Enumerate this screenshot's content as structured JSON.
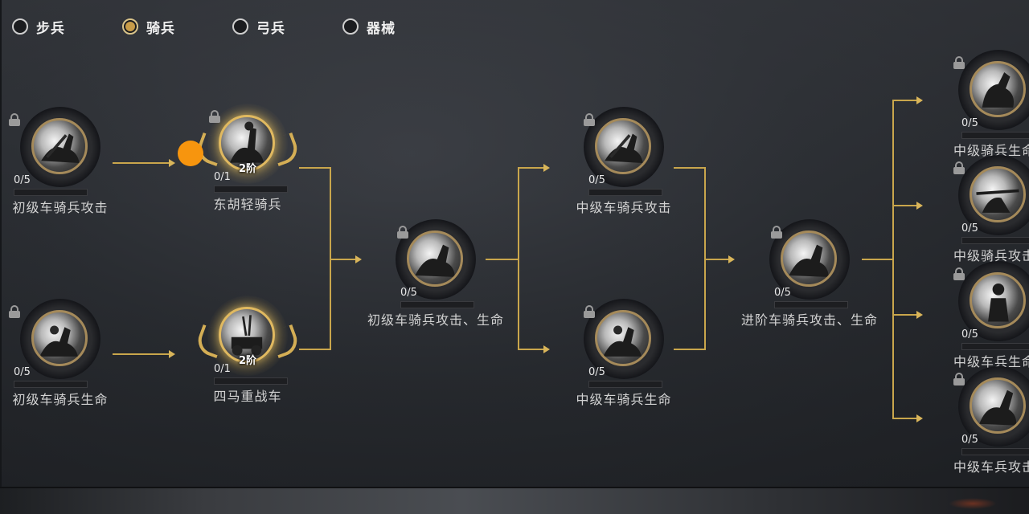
{
  "tabs": [
    {
      "label": "步兵",
      "selected": false
    },
    {
      "label": "骑兵",
      "selected": true
    },
    {
      "label": "弓兵",
      "selected": false
    },
    {
      "label": "器械",
      "selected": false
    }
  ],
  "colors": {
    "accent_gold": "#c9a64c",
    "hint_dot": "#f7950e"
  },
  "nodes": {
    "n1": {
      "name": "初级车骑兵攻击",
      "count": "0/5",
      "locked": true
    },
    "n2": {
      "name": "东胡轻骑兵",
      "count": "0/1",
      "tier": "2阶",
      "locked": true
    },
    "n3": {
      "name": "初级车骑兵生命",
      "count": "0/5",
      "locked": true
    },
    "n4": {
      "name": "四马重战车",
      "count": "0/1",
      "tier": "2阶",
      "locked": true
    },
    "n5": {
      "name": "初级车骑兵攻击、生命",
      "count": "0/5",
      "locked": true
    },
    "n6": {
      "name": "中级车骑兵攻击",
      "count": "0/5",
      "locked": true
    },
    "n7": {
      "name": "中级车骑兵生命",
      "count": "0/5",
      "locked": true
    },
    "n8": {
      "name": "进阶车骑兵攻击、生命",
      "count": "0/5",
      "locked": true
    },
    "n9": {
      "name": "中级骑兵生命",
      "count": "0/5",
      "locked": true
    },
    "n10": {
      "name": "中级骑兵攻击",
      "count": "0/5",
      "locked": true
    },
    "n11": {
      "name": "中级车兵生命",
      "count": "0/5",
      "locked": true
    },
    "n12": {
      "name": "中级车兵攻击",
      "count": "0/5",
      "locked": true
    }
  }
}
